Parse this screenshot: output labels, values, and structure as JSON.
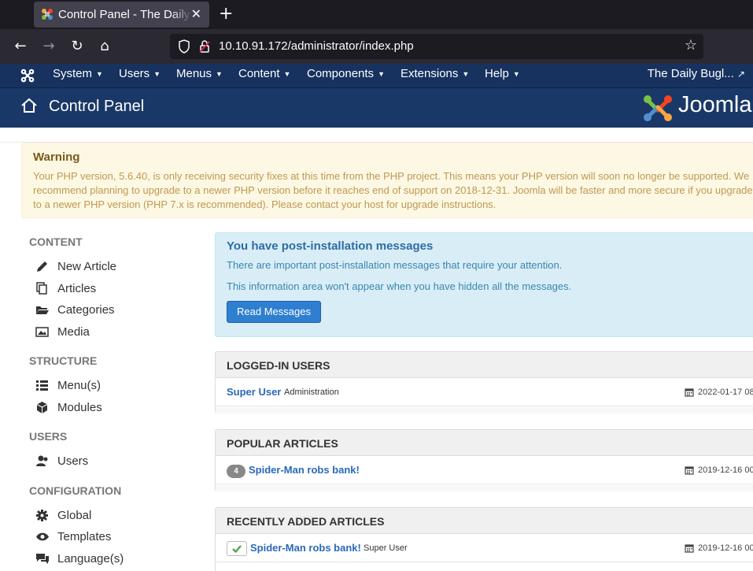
{
  "browser": {
    "tab_title": "Control Panel - The Daily Bugle",
    "url": "10.10.91.172/administrator/index.php"
  },
  "admin_menu": {
    "items": [
      "System",
      "Users",
      "Menus",
      "Content",
      "Components",
      "Extensions",
      "Help"
    ],
    "site_link": "The Daily Bugl..."
  },
  "header": {
    "title": "Control Panel",
    "brand": "Joomla!"
  },
  "warning": {
    "title": "Warning",
    "text": "Your PHP version, 5.6.40, is only receiving security fixes at this time from the PHP project. This means your PHP version will soon no longer be supported. We recommend planning to upgrade to a newer PHP version before it reaches end of support on 2018-12-31. Joomla will be faster and more secure if you upgrade to a newer PHP version (PHP 7.x is recommended). Please contact your host for upgrade instructions."
  },
  "sidebar": {
    "content_head": "CONTENT",
    "new_article": "New Article",
    "articles": "Articles",
    "categories": "Categories",
    "media": "Media",
    "structure_head": "STRUCTURE",
    "menus": "Menu(s)",
    "modules": "Modules",
    "users_head": "USERS",
    "users": "Users",
    "config_head": "CONFIGURATION",
    "global": "Global",
    "templates": "Templates",
    "languages": "Language(s)"
  },
  "postinstall": {
    "title": "You have post-installation messages",
    "line1": "There are important post-installation messages that require your attention.",
    "line2": "This information area won't appear when you have hidden all the messages.",
    "button": "Read Messages"
  },
  "logged_in": {
    "title": "LOGGED-IN USERS",
    "user": "Super User",
    "role": "Administration",
    "date": "2022-01-17 08:"
  },
  "popular": {
    "title": "POPULAR ARTICLES",
    "hits": "4",
    "article": "Spider-Man robs bank!",
    "date": "2019-12-16 00:"
  },
  "recent": {
    "title": "RECENTLY ADDED ARTICLES",
    "article": "Spider-Man robs bank!",
    "author": "Super User",
    "date": "2019-12-16 00:"
  },
  "colors": {
    "menu_bg": "#17325f",
    "header_bg": "#1a3867",
    "link": "#2a69b8",
    "warning_bg": "#fcf8e3",
    "info_bg": "#d9edf7"
  }
}
